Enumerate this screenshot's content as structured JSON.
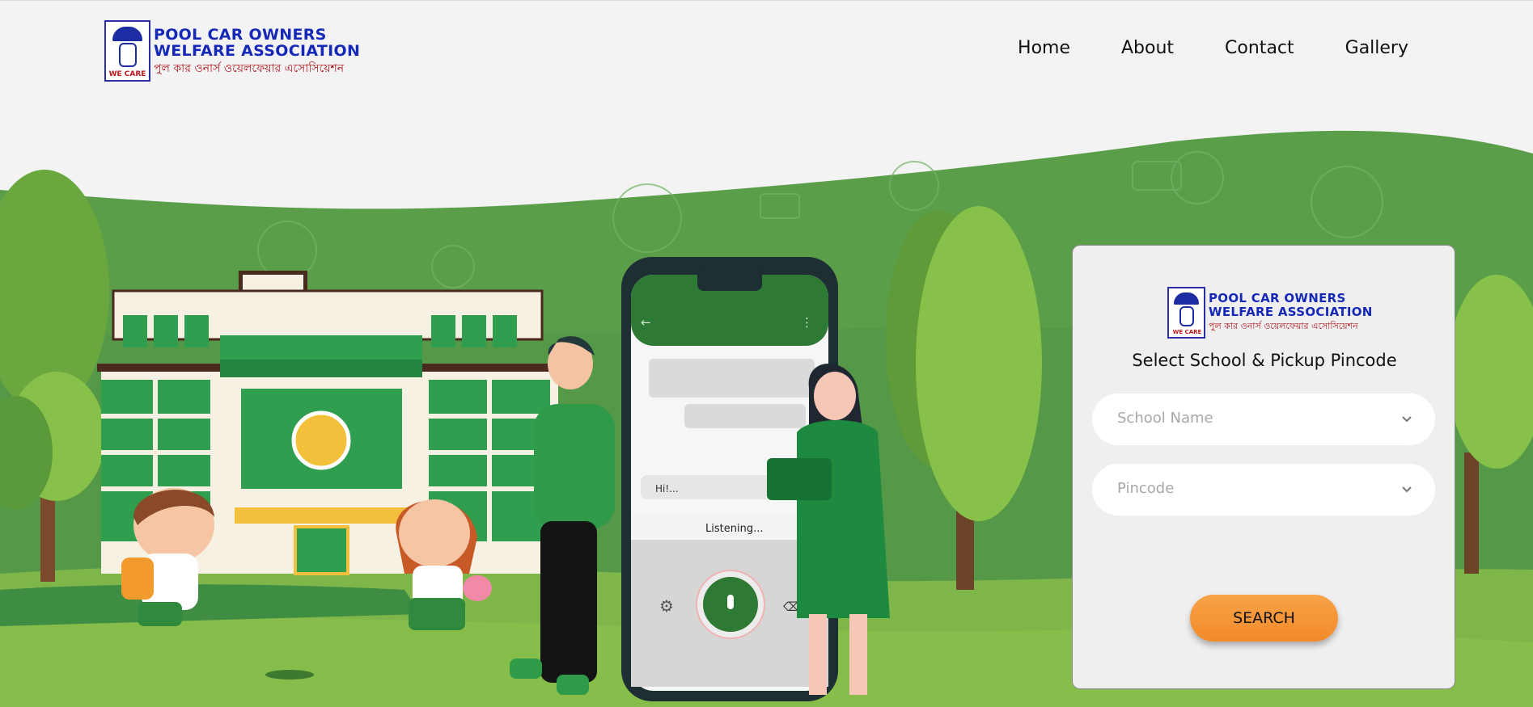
{
  "logo": {
    "line1": "POOL CAR OWNERS",
    "line2": "WELFARE ASSOCIATION",
    "bengali": "পুল কার ওনার্স ওয়েলফেয়ার এসোসিয়েশন",
    "badge": "WE CARE"
  },
  "nav": {
    "items": [
      {
        "label": "Home"
      },
      {
        "label": "About"
      },
      {
        "label": "Contact"
      },
      {
        "label": "Gallery"
      }
    ]
  },
  "hero": {
    "phone_greeting": "Hi!...",
    "phone_status": "Listening..."
  },
  "search_card": {
    "title": "Select School & Pickup Pincode",
    "school": {
      "placeholder": "School Name"
    },
    "pincode": {
      "placeholder": "Pincode"
    },
    "button": "SEARCH"
  },
  "colors": {
    "brand_blue": "#1628b8",
    "brand_red": "#b0151d",
    "button_orange": "#f79a3c",
    "grass_green": "#5fa64f"
  },
  "icons": [
    "chevron-down-icon",
    "gear-icon",
    "microphone-icon",
    "back-arrow-icon",
    "more-vert-icon",
    "backspace-icon"
  ]
}
